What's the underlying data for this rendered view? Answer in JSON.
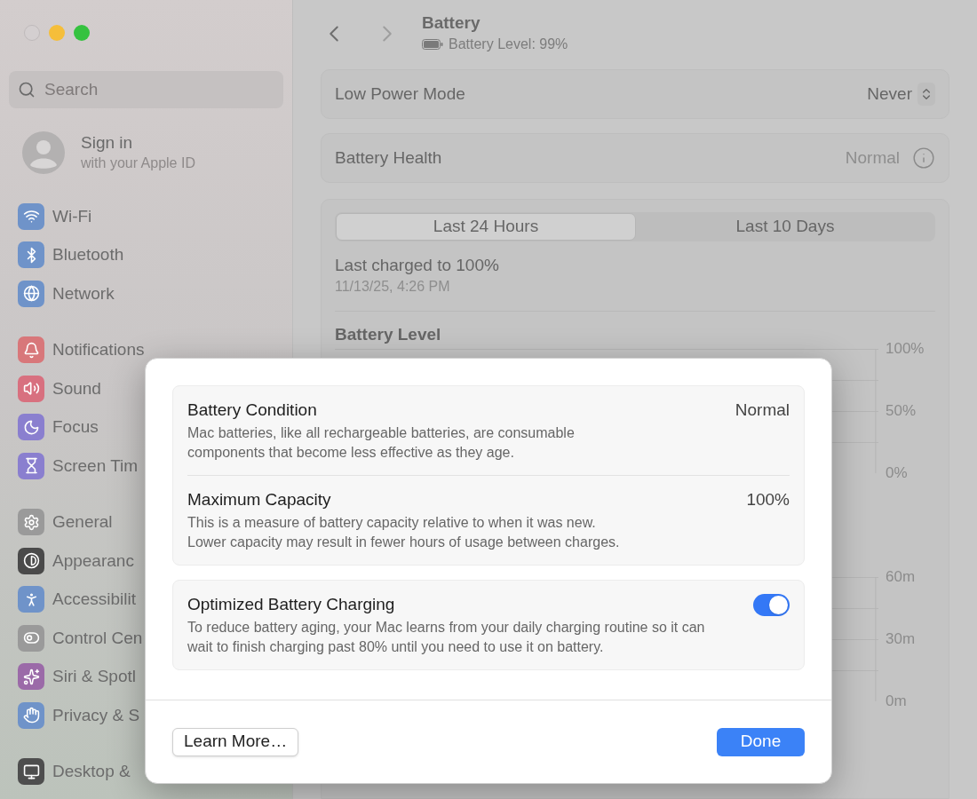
{
  "sidebar": {
    "search": {
      "placeholder": "Search"
    },
    "account": {
      "title": "Sign in",
      "subtitle": "with your Apple ID"
    },
    "groups": [
      [
        {
          "label": "Wi-Fi",
          "kind": "wifi",
          "color": "#6f93c9"
        },
        {
          "label": "Bluetooth",
          "kind": "bluetooth",
          "color": "#6f93c9"
        },
        {
          "label": "Network",
          "kind": "globe",
          "color": "#6f93c9"
        }
      ],
      [
        {
          "label": "Notifications",
          "kind": "bell",
          "color": "#d8777a"
        },
        {
          "label": "Sound",
          "kind": "sound",
          "color": "#d8707f"
        },
        {
          "label": "Focus",
          "kind": "moon",
          "color": "#8a7fcf"
        },
        {
          "label": "Screen Tim",
          "kind": "hourglass",
          "color": "#8a7fcf"
        }
      ],
      [
        {
          "label": "General",
          "kind": "gear",
          "color": "#9a9a9a"
        },
        {
          "label": "Appearanc",
          "kind": "contrast",
          "color": "#4a4a4a"
        },
        {
          "label": "Accessibilit",
          "kind": "person",
          "color": "#6f93c9"
        },
        {
          "label": "Control Cen",
          "kind": "toggles",
          "color": "#9a9a9a"
        },
        {
          "label": "Siri & Spotl",
          "kind": "sparkles",
          "color": "#9b6aa8"
        },
        {
          "label": "Privacy & S",
          "kind": "hand",
          "color": "#6f93c9"
        }
      ],
      [
        {
          "label": "Desktop & ",
          "kind": "monitor",
          "color": "#4e4e4e"
        }
      ]
    ]
  },
  "main": {
    "title": "Battery",
    "subtitle": "Battery Level: 99%",
    "rows": [
      {
        "label": "Low Power Mode",
        "value": "Never",
        "kind": "popup"
      },
      {
        "label": "Battery Health",
        "value": "Normal",
        "kind": "info"
      }
    ],
    "tabs": [
      {
        "label": "Last 24 Hours",
        "selected": true
      },
      {
        "label": "Last 10 Days",
        "selected": false
      }
    ],
    "last_charged": {
      "title": "Last charged to 100%",
      "time": "11/13/25, 4:26 PM"
    },
    "battery_level_chart": {
      "title": "Battery Level",
      "axis_labels": [
        "100%",
        "50%",
        "0%"
      ]
    },
    "usage_chart": {
      "axis_labels": [
        "60m",
        "30m",
        "0m"
      ]
    }
  },
  "dialog": {
    "sections": [
      {
        "items": [
          {
            "kind": "text",
            "title": "Battery Condition",
            "value": "Normal",
            "description": "Mac batteries, like all rechargeable batteries, are consumable components that become less effective as they age."
          },
          {
            "kind": "text",
            "title": "Maximum Capacity",
            "value": "100%",
            "description": "This is a measure of battery capacity relative to when it was new. Lower capacity may result in fewer hours of usage between charges."
          }
        ]
      },
      {
        "items": [
          {
            "kind": "toggle",
            "title": "Optimized Battery Charging",
            "on": true,
            "description": "To reduce battery aging, your Mac learns from your daily charging routine so it can wait to finish charging past 80% until you need to use it on battery."
          }
        ]
      }
    ],
    "buttons": [
      {
        "label": "Learn More…",
        "kind": "default"
      },
      {
        "label": "Done",
        "kind": "primary"
      }
    ]
  }
}
